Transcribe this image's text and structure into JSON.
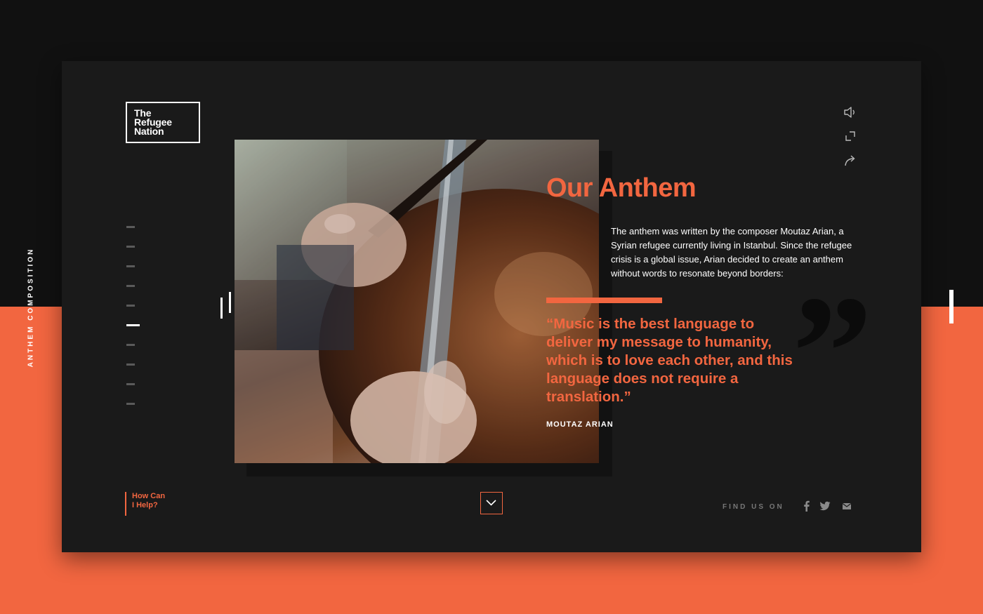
{
  "side": {
    "label": "ANTHEM COMPOSITION"
  },
  "logo": {
    "line1": "The",
    "line2": "Refugee",
    "line3": "Nation"
  },
  "nav": {
    "sections": 10,
    "active_index": 5
  },
  "toolbar": {
    "icons": [
      "speaker-icon",
      "expand-icon",
      "share-icon"
    ]
  },
  "content": {
    "title": "Our Anthem",
    "intro": "The anthem was written by the composer Moutaz Arian, a Syrian refugee currently living in Istanbul. Since the refugee crisis is a global issue, Arian decided to create an anthem without words to resonate beyond borders:",
    "quote": "“Music is the best language to deliver my message to humanity, which is to love each other, and this language does not require a translation.”",
    "author": "MOUTAZ ARIAN",
    "quote_mark": "”"
  },
  "footer": {
    "help_line1": "How Can",
    "help_line2": "I Help?",
    "find_label": "FIND US ON",
    "social_icons": [
      "facebook-icon",
      "twitter-icon",
      "mail-icon"
    ]
  },
  "colors": {
    "accent": "#f26640",
    "panel": "#1a1a1a",
    "background": "#111111"
  }
}
